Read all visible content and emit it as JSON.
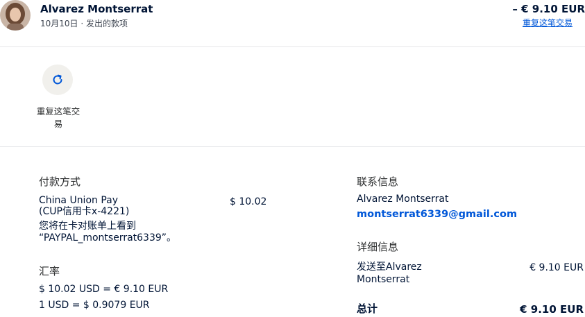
{
  "header": {
    "name": "Alvarez Montserrat",
    "subtitle": "10月10日 · 发出的款项",
    "amount": "– € 9.10 EUR",
    "repeat_link": "重复这笔交易"
  },
  "actions": {
    "repeat_label": "重复这笔交易"
  },
  "payment": {
    "title": "付款方式",
    "method_line1": "China Union Pay",
    "method_line2": "(CUP信用卡x-4221)",
    "statement_line1": "您将在卡对账单上看到",
    "statement_line2": "“PAYPAL_montserrat6339”。",
    "amount": "$ 10.02"
  },
  "exchange": {
    "title": "汇率",
    "line1": "$ 10.02 USD = € 9.10 EUR",
    "line2": "1 USD = $ 0.9079 EUR"
  },
  "contact": {
    "title": "联系信息",
    "name": "Alvarez Montserrat",
    "email": "montserrat6339@gmail.com"
  },
  "details": {
    "title": "详细信息",
    "sent_to_line1": "发送至Alvarez",
    "sent_to_line2": "Montserrat",
    "sent_amount": "€ 9.10 EUR",
    "total_label": "总计",
    "total_amount": "€ 9.10 EUR"
  },
  "colors": {
    "text": "#001435",
    "link": "#0057d8",
    "action_circle": "#f1f0ec"
  }
}
